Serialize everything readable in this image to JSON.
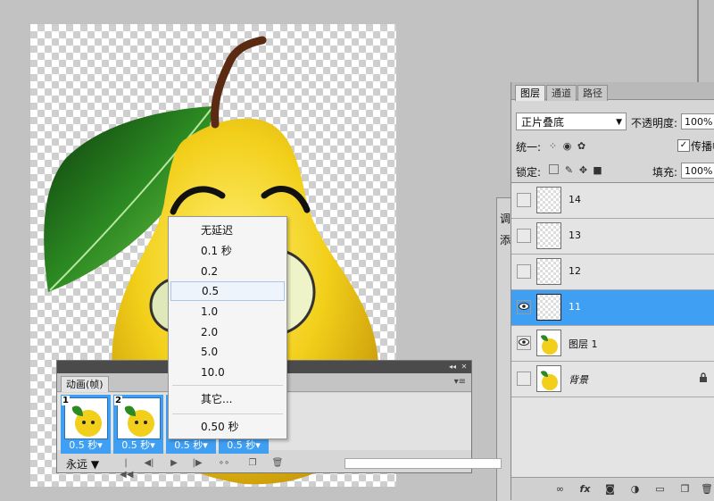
{
  "layers_panel": {
    "tabs": [
      "图层",
      "通道",
      "路径"
    ],
    "blend_mode": "正片叠底",
    "opacity_label": "不透明度:",
    "opacity_value": "100%",
    "unify_label": "统一:",
    "propagate_label": "传播帧",
    "lock_label": "锁定:",
    "fill_label": "填充:",
    "fill_value": "100%",
    "layers": [
      {
        "name": "14",
        "visible": false,
        "selected": false
      },
      {
        "name": "13",
        "visible": false,
        "selected": false
      },
      {
        "name": "12",
        "visible": false,
        "selected": false
      },
      {
        "name": "11",
        "visible": true,
        "selected": true
      },
      {
        "name": "图层 1",
        "visible": true,
        "selected": false
      },
      {
        "name": "背景",
        "visible": false,
        "selected": false,
        "locked": true
      }
    ],
    "footer_icons": [
      "link-icon",
      "fx-icon",
      "mask-icon",
      "adjustment-icon",
      "folder-icon",
      "new-layer-icon",
      "trash-icon"
    ]
  },
  "hidden_panel": {
    "labels": [
      "调",
      "添"
    ]
  },
  "animation_panel": {
    "title": "动画(帧)",
    "frames": [
      {
        "number": "1",
        "delay": "0.5 秒"
      },
      {
        "number": "2",
        "delay": "0.5 秒"
      },
      {
        "number": "",
        "delay": "0.5 秒"
      },
      {
        "number": "",
        "delay": "0.5 秒"
      }
    ],
    "loop_option": "永远"
  },
  "delay_menu": {
    "items": [
      "无延迟",
      "0.1 秒",
      "0.2",
      "0.5",
      "1.0",
      "2.0",
      "5.0",
      "10.0"
    ],
    "other": "其它...",
    "current": "0.50 秒",
    "highlighted_index": 3
  },
  "colors": {
    "selection_blue": "#3f9ff3",
    "panel_gray": "#d6d6d6",
    "workspace_gray": "#c2c2c2"
  }
}
